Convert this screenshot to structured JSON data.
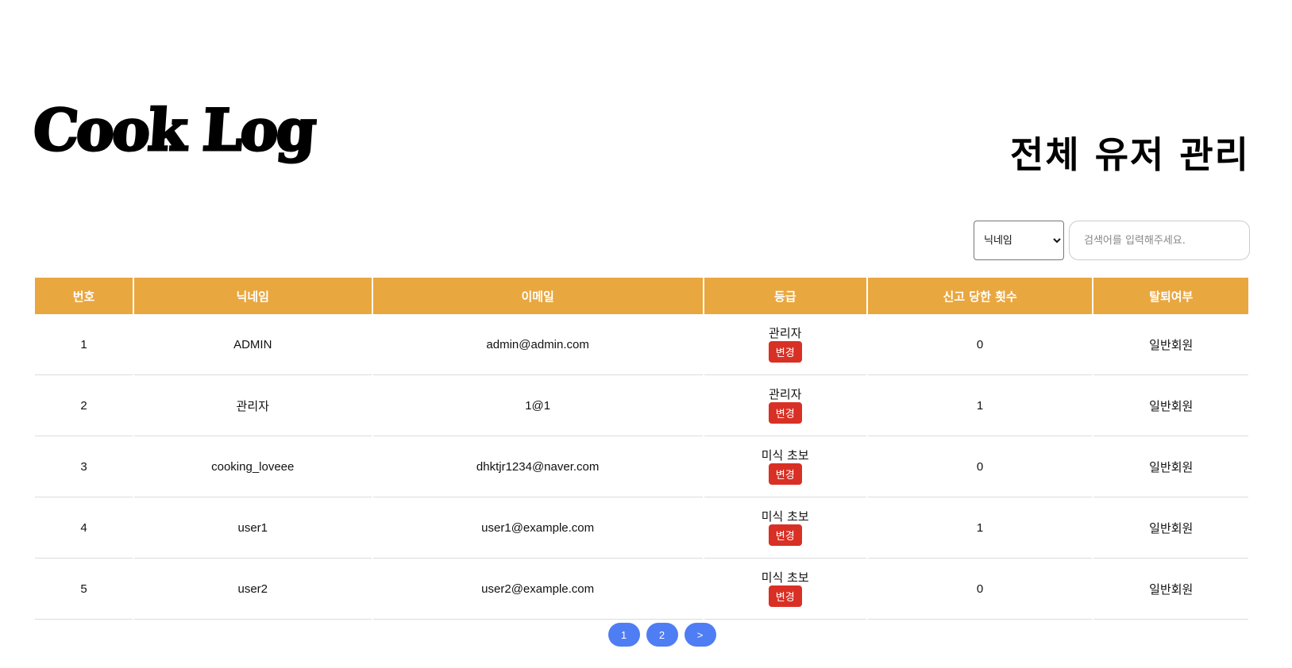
{
  "header": {
    "logo": "Cook Log",
    "title": "전체 유저 관리"
  },
  "search": {
    "select_value": "닉네임",
    "options": [
      "닉네임"
    ],
    "placeholder": "검색어를 입력해주세요."
  },
  "table": {
    "columns": [
      "번호",
      "닉네임",
      "이메일",
      "등급",
      "신고 당한 횟수",
      "탈퇴여부"
    ],
    "change_label": "변경",
    "rows": [
      {
        "no": "1",
        "nickname": "ADMIN",
        "email": "admin@admin.com",
        "grade": "관리자",
        "reports": "0",
        "status": "일반회원"
      },
      {
        "no": "2",
        "nickname": "관리자",
        "email": "1@1",
        "grade": "관리자",
        "reports": "1",
        "status": "일반회원"
      },
      {
        "no": "3",
        "nickname": "cooking_loveee",
        "email": "dhktjr1234@naver.com",
        "grade": "미식 초보",
        "reports": "0",
        "status": "일반회원"
      },
      {
        "no": "4",
        "nickname": "user1",
        "email": "user1@example.com",
        "grade": "미식 초보",
        "reports": "1",
        "status": "일반회원"
      },
      {
        "no": "5",
        "nickname": "user2",
        "email": "user2@example.com",
        "grade": "미식 초보",
        "reports": "0",
        "status": "일반회원"
      }
    ]
  },
  "pagination": {
    "pages": [
      "1",
      "2"
    ],
    "next_label": ">"
  },
  "colors": {
    "header_bg": "#E9A73F",
    "change_button": "#D93025",
    "page_button": "#4F7DF3"
  }
}
